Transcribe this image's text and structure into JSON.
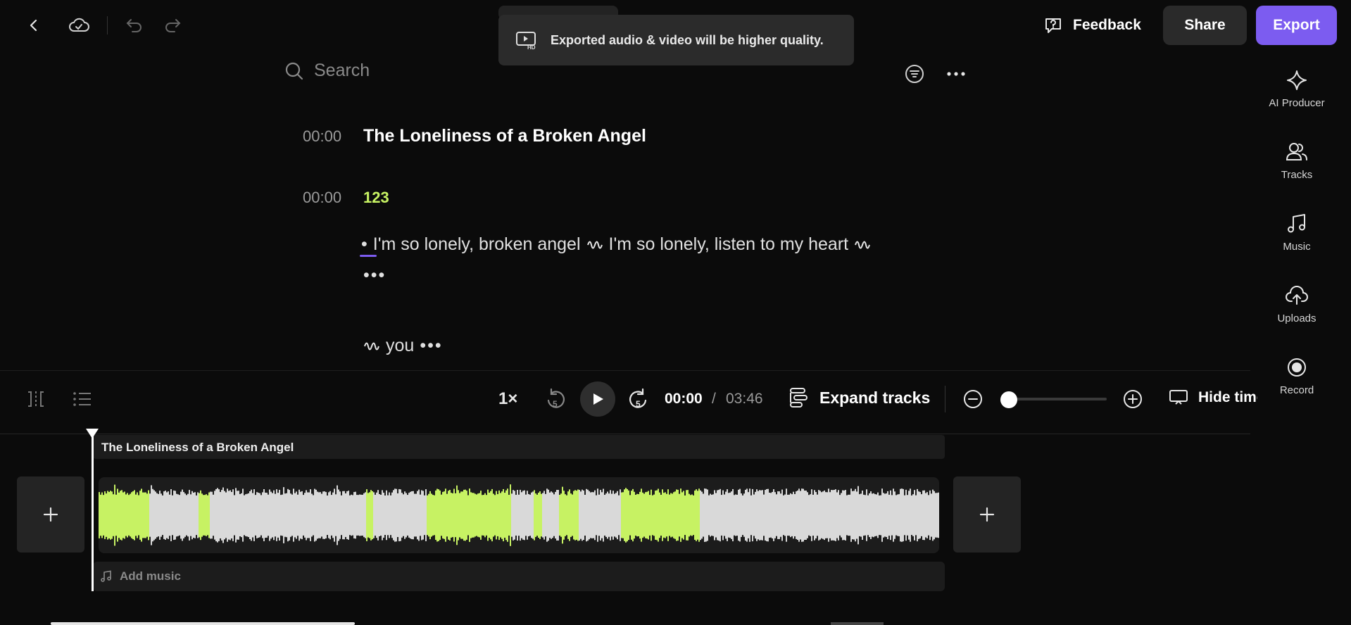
{
  "toast": {
    "text": "Exported audio & video will be higher quality."
  },
  "header": {
    "feedback_label": "Feedback",
    "share_label": "Share",
    "export_label": "Export"
  },
  "search": {
    "placeholder": "Search"
  },
  "transcript": {
    "rows": [
      {
        "time": "00:00",
        "text": "The Loneliness of a Broken Angel"
      },
      {
        "time": "00:00",
        "text": "123"
      }
    ],
    "lyric1_a": "I'm so lonely, broken angel",
    "lyric1_b": "I'm so lonely, listen to my heart",
    "lyric2": "you",
    "bullet": "•",
    "ellipsis": "•••"
  },
  "sidebar": {
    "items": [
      {
        "label": "AI Producer",
        "icon": "sparkle-icon"
      },
      {
        "label": "Tracks",
        "icon": "users-icon"
      },
      {
        "label": "Music",
        "icon": "music-note-icon"
      },
      {
        "label": "Uploads",
        "icon": "cloud-upload-icon"
      },
      {
        "label": "Record",
        "icon": "record-icon"
      }
    ]
  },
  "player": {
    "speed": "1×",
    "skip_seconds": "5",
    "current_time": "00:00",
    "separator": "/",
    "total_time": "03:46",
    "expand_label": "Expand tracks",
    "hide_label": "Hide timeline",
    "zoom_level": 0.0
  },
  "timeline": {
    "clip_title": "The Loneliness of a Broken Angel",
    "add_music_label": "Add music",
    "colors": {
      "highlight": "#c7f263",
      "wave": "#d9d9d9",
      "accent": "#7c5cf0"
    },
    "highlight_segments": [
      [
        0.0,
        0.06
      ],
      [
        0.118,
        0.131
      ],
      [
        0.317,
        0.325
      ],
      [
        0.39,
        0.49
      ],
      [
        0.517,
        0.526
      ],
      [
        0.547,
        0.57
      ],
      [
        0.62,
        0.715
      ]
    ]
  }
}
